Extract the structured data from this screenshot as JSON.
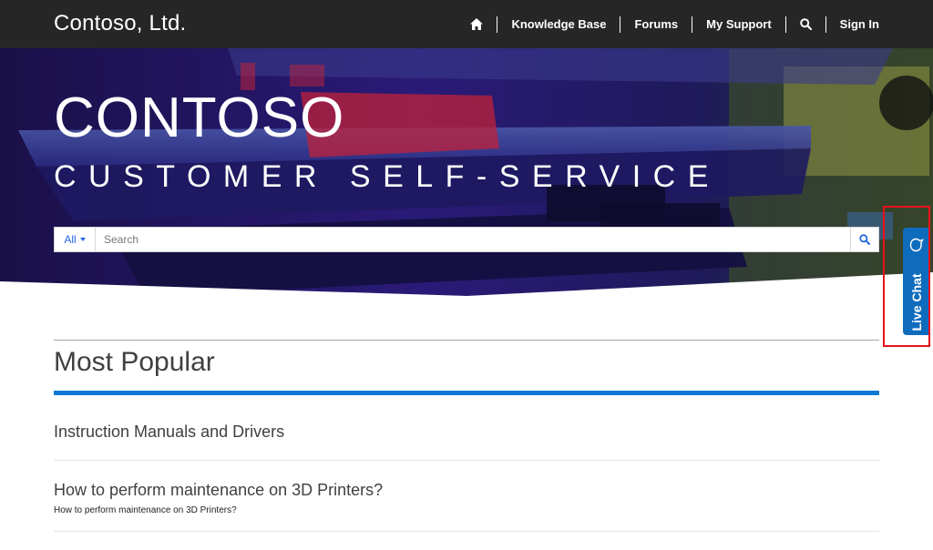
{
  "header": {
    "brand": "Contoso, Ltd.",
    "nav": [
      {
        "label": "Knowledge Base"
      },
      {
        "label": "Forums"
      },
      {
        "label": "My Support"
      },
      {
        "label": "Sign In"
      }
    ],
    "icons": [
      "home-icon",
      "search-icon"
    ]
  },
  "hero": {
    "title": "CONTOSO",
    "subtitle": "CUSTOMER SELF-SERVICE"
  },
  "search": {
    "filter_label": "All",
    "placeholder": "Search",
    "value": ""
  },
  "popular": {
    "heading": "Most Popular",
    "items": [
      {
        "title": "Instruction Manuals and Drivers",
        "description": ""
      },
      {
        "title": "How to perform maintenance on 3D Printers?",
        "description": "How to perform maintenance on 3D Printers?"
      }
    ]
  },
  "live_chat": {
    "label": "Live Chat",
    "icon": "chat-bubble-icon"
  },
  "colors": {
    "nav_bg": "#262626",
    "accent_blue": "#0f78d4",
    "live_chat_bg": "#0f6cbd",
    "highlight": "#e8121a",
    "link_blue": "#2266e3"
  }
}
